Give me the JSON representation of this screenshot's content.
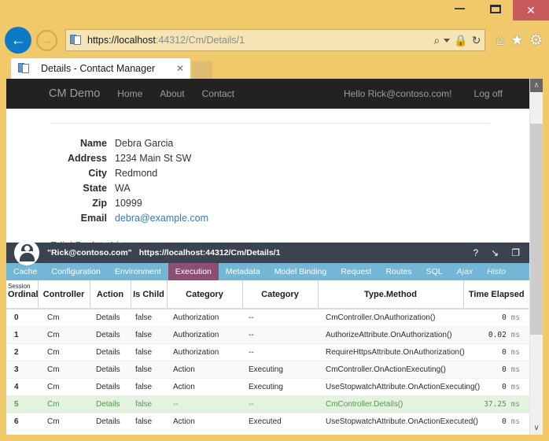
{
  "window": {
    "minimize_label": "—",
    "maximize_label": "❐",
    "close_label": "✕"
  },
  "browser": {
    "back_icon": "←",
    "forward_icon": "→",
    "url_scheme": "https://localhost",
    "url_rest": ":44312/Cm/Details/1",
    "url_full": "https://localhost:44312/Cm/Details/1",
    "search_icon": "⌕",
    "lock_icon": "🔒",
    "refresh_icon": "↻",
    "home_icon": "⌂",
    "favorites_icon": "★",
    "settings_icon": "⚙",
    "tab_title": "Details - Contact Manager",
    "tab_close": "✕"
  },
  "site": {
    "brand": "CM Demo",
    "nav": [
      {
        "label": "Home"
      },
      {
        "label": "About"
      },
      {
        "label": "Contact"
      }
    ],
    "greeting": "Hello Rick@contoso.com!",
    "logoff": "Log off"
  },
  "details": {
    "fields": [
      {
        "label": "Name",
        "value": "Debra Garcia",
        "link": false
      },
      {
        "label": "Address",
        "value": "1234 Main St SW",
        "link": false
      },
      {
        "label": "City",
        "value": "Redmond",
        "link": false
      },
      {
        "label": "State",
        "value": "WA",
        "link": false
      },
      {
        "label": "Zip",
        "value": "10999",
        "link": false
      },
      {
        "label": "Email",
        "value": "debra@example.com",
        "link": true
      }
    ],
    "edit_link": "Edit",
    "separator": " | ",
    "back_link": "Back to List"
  },
  "glimpse": {
    "user": "\"Rick@contoso.com\"",
    "url": "https://localhost:44312/Cm/Details/1",
    "help_icon": "?",
    "minimize_icon": "↘",
    "popout_icon": "❐",
    "tabs": [
      {
        "label": "Cache",
        "active": false,
        "italic": false
      },
      {
        "label": "Configuration",
        "active": false,
        "italic": false
      },
      {
        "label": "Environment",
        "active": false,
        "italic": false
      },
      {
        "label": "Execution",
        "active": true,
        "italic": false
      },
      {
        "label": "Metadata",
        "active": false,
        "italic": false
      },
      {
        "label": "Model Binding",
        "active": false,
        "italic": false
      },
      {
        "label": "Request",
        "active": false,
        "italic": false
      },
      {
        "label": "Routes",
        "active": false,
        "italic": false
      },
      {
        "label": "SQL",
        "active": false,
        "italic": false
      },
      {
        "label": "Ajax",
        "active": false,
        "italic": true
      },
      {
        "label": "Histo",
        "active": false,
        "italic": true
      }
    ],
    "table": {
      "session_overlay": "Session",
      "headers": [
        "Ordinal",
        "Controller",
        "Action",
        "Is Child",
        "Category",
        "Category",
        "Type.Method",
        "Time Elapsed"
      ],
      "rows": [
        {
          "ordinal": "0",
          "controller": "Cm",
          "action": "Details",
          "is_child": "false",
          "category1": "Authorization",
          "category2": "--",
          "type_method": "CmController.OnAuthorization()",
          "time": "0",
          "unit": "ms",
          "highlight": false
        },
        {
          "ordinal": "1",
          "controller": "Cm",
          "action": "Details",
          "is_child": "false",
          "category1": "Authorization",
          "category2": "--",
          "type_method": "AuthorizeAttribute.OnAuthorization()",
          "time": "0.02",
          "unit": "ms",
          "highlight": false
        },
        {
          "ordinal": "2",
          "controller": "Cm",
          "action": "Details",
          "is_child": "false",
          "category1": "Authorization",
          "category2": "--",
          "type_method": "RequireHttpsAttribute.OnAuthorization()",
          "time": "0",
          "unit": "ms",
          "highlight": false
        },
        {
          "ordinal": "3",
          "controller": "Cm",
          "action": "Details",
          "is_child": "false",
          "category1": "Action",
          "category2": "Executing",
          "type_method": "CmController.OnActionExecuting()",
          "time": "0",
          "unit": "ms",
          "highlight": false
        },
        {
          "ordinal": "4",
          "controller": "Cm",
          "action": "Details",
          "is_child": "false",
          "category1": "Action",
          "category2": "Executing",
          "type_method": "UseStopwatchAttribute.OnActionExecuting()",
          "time": "0",
          "unit": "ms",
          "highlight": false
        },
        {
          "ordinal": "5",
          "controller": "Cm",
          "action": "Details",
          "is_child": "false",
          "category1": "--",
          "category2": "--",
          "type_method": "CmController.Details()",
          "time": "37.25",
          "unit": "ms",
          "highlight": true
        },
        {
          "ordinal": "6",
          "controller": "Cm",
          "action": "Details",
          "is_child": "false",
          "category1": "Action",
          "category2": "Executed",
          "type_method": "UseStopwatchAttribute.OnActionExecuted()",
          "time": "0",
          "unit": "ms",
          "highlight": false
        }
      ]
    }
  },
  "scrollbar": {
    "up_icon": "∧",
    "down_icon": "∨"
  },
  "colors": {
    "chrome": "#efc96a",
    "close_button": "#c75b5b",
    "back_button": "#0e7ac4",
    "navbar": "#222222",
    "glimpse_header": "#3b4250",
    "glimpse_tabs": "#74b6d6",
    "glimpse_active_tab": "#8a4f72",
    "link": "#337ab7",
    "highlight_row_bg": "#e4f3df",
    "highlight_row_fg": "#4d9e4d"
  }
}
